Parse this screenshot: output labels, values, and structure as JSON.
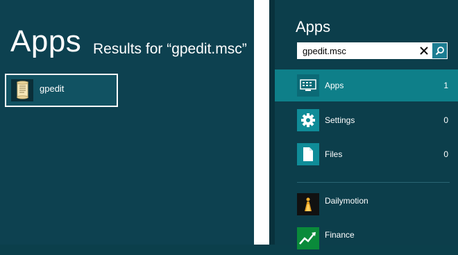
{
  "results": {
    "title": "Apps",
    "subtitle": "Results for “gpedit.msc”",
    "items": [
      {
        "label": "gpedit",
        "icon": "scroll-document-icon"
      }
    ]
  },
  "search_pane": {
    "title": "Apps",
    "query": "gpedit.msc",
    "categories": [
      {
        "label": "Apps",
        "count": "1",
        "icon": "apps-keyboard-icon",
        "selected": true
      },
      {
        "label": "Settings",
        "count": "0",
        "icon": "gear-icon",
        "selected": false
      },
      {
        "label": "Files",
        "count": "0",
        "icon": "file-icon",
        "selected": false
      }
    ],
    "apps": [
      {
        "label": "Dailymotion",
        "icon": "dailymotion-icon"
      },
      {
        "label": "Finance",
        "icon": "finance-chart-icon"
      }
    ]
  },
  "colors": {
    "background": "#0d4150",
    "selected_category": "#0e7f89",
    "search_button": "#1c7d92",
    "settings_tile": "#0f8c98",
    "finance_tile": "#0a8a3a"
  }
}
